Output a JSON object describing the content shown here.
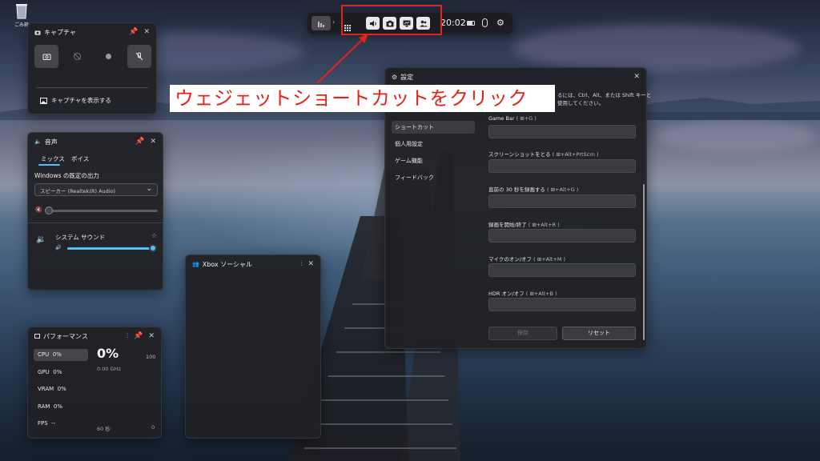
{
  "desktop": {
    "recycle_bin_label": "ごみ箱"
  },
  "topbar": {
    "clock": "20:02",
    "buttons": [
      "audio-widget",
      "capture-widget",
      "performance-widget",
      "xbox-social-widget"
    ]
  },
  "annotation": {
    "callout_text": "ウェジェットショートカットをクリック",
    "highlight_color": "#e3241b"
  },
  "capture": {
    "title": "キャプチャ",
    "show_captures_link": "キャプチャを表示する"
  },
  "audio": {
    "title": "音声",
    "tabs": [
      "ミックス",
      "ボイス"
    ],
    "output_label": "Windows の既定の出力",
    "output_device": "スピーカー (Realtek(R) Audio)",
    "master_volume": 0,
    "app_name": "システム サウンド",
    "app_volume": 100
  },
  "performance": {
    "title": "パフォーマンス",
    "rows": [
      {
        "label": "CPU",
        "value": "0%"
      },
      {
        "label": "GPU",
        "value": "0%"
      },
      {
        "label": "VRAM",
        "value": "0%"
      },
      {
        "label": "RAM",
        "value": "0%"
      },
      {
        "label": "FPS",
        "value": "--"
      }
    ],
    "big_value": "0%",
    "sub_value": "0.00 GHz",
    "scale_max": "100",
    "time_axis_label": "60 秒",
    "scale_min": "0"
  },
  "social": {
    "title": "Xbox ソーシャル"
  },
  "settings": {
    "title": "設定",
    "intro_line1": "るには、Ctrl、Alt、または Shift キーと",
    "intro_line2": "使用してください。",
    "nav": [
      "ショートカット",
      "個人用設定",
      "ゲーム機能",
      "フィードバック"
    ],
    "shortcuts": [
      {
        "label": "Game Bar",
        "keys": "( ⊞+G )"
      },
      {
        "label": "スクリーンショットをとる",
        "keys": "( ⊞+Alt+PrtScrn )"
      },
      {
        "label": "直前の 30 秒を録画する",
        "keys": "( ⊞+Alt+G )"
      },
      {
        "label": "録画を開始/終了",
        "keys": "( ⊞+Alt+R )"
      },
      {
        "label": "マイクのオン/オフ",
        "keys": "( ⊞+Alt+M )"
      },
      {
        "label": "HDR オン/オフ",
        "keys": "( ⊞+Alt+B )"
      }
    ],
    "save_label": "保存",
    "reset_label": "リセット"
  }
}
